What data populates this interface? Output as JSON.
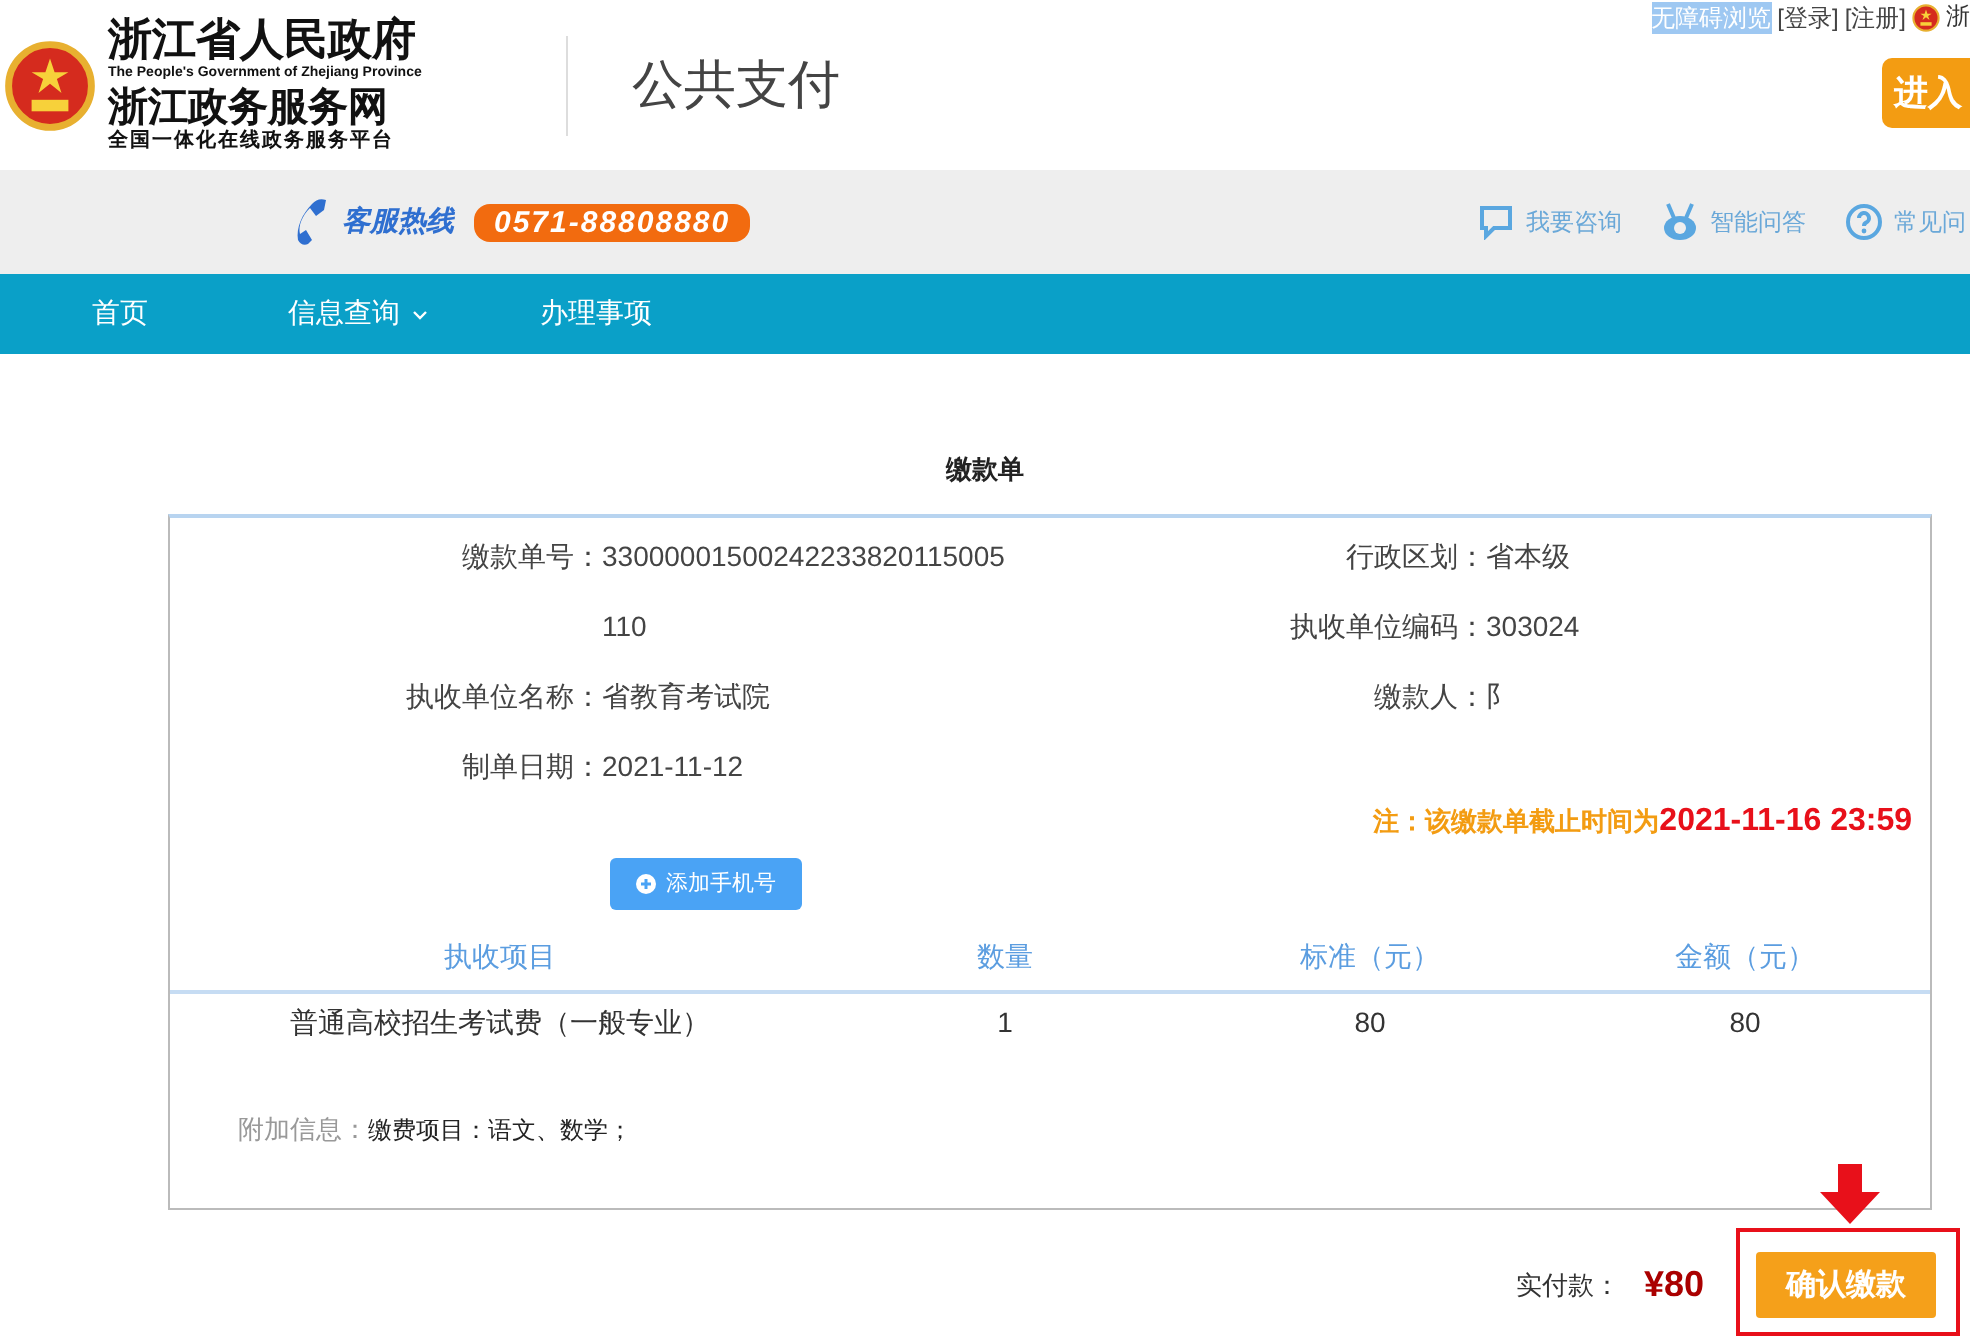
{
  "header": {
    "site_title": "浙江省人民政府",
    "site_subtitle_en": "The People's Government of Zhejiang Province",
    "site_name": "浙江政务服务网",
    "site_slogan": "全国一体化在线政务服务平台",
    "page_title": "公共支付",
    "top_links": [
      {
        "label": "无障碍浏览",
        "highlighted": true
      },
      {
        "label": "[登录]",
        "highlighted": false
      },
      {
        "label": "[注册]",
        "highlighted": false
      }
    ],
    "region_label": "浙",
    "enter_button": "进入"
  },
  "hotline": {
    "label": "客服热线",
    "number": "0571-88808880"
  },
  "help_links": [
    {
      "label": "我要咨询",
      "kind": "chat"
    },
    {
      "label": "智能问答",
      "kind": "robot"
    },
    {
      "label": "常见问",
      "kind": "question"
    }
  ],
  "nav": [
    {
      "label": "首页",
      "dropdown": false
    },
    {
      "label": "信息查询",
      "dropdown": true
    },
    {
      "label": "办理事项",
      "dropdown": false
    }
  ],
  "bill": {
    "title": "缴款单",
    "left_fields": [
      {
        "label": "缴款单号：",
        "value": "33000001500242233820115005110"
      },
      {
        "label": "执收单位名称：",
        "value": "省教育考试院"
      },
      {
        "label": "制单日期：",
        "value": "2021-11-12"
      }
    ],
    "right_fields": [
      {
        "label": "行政区划：",
        "value": "省本级"
      },
      {
        "label": "执收单位编码：",
        "value": "303024"
      },
      {
        "label": "缴款人：",
        "value": "阝"
      }
    ],
    "note": {
      "prefix": "注：该缴款单截止时间为",
      "deadline": "2021-11-16 23:59"
    },
    "add_phone_button": "添加手机号",
    "table": {
      "columns": [
        "执收项目",
        "数量",
        "标准（元）",
        "金额（元）"
      ],
      "rows": [
        [
          "普通高校招生考试费（一般专业）",
          "1",
          "80",
          "80"
        ]
      ]
    },
    "extra_info": {
      "label": "附加信息：",
      "value": "缴费项目：语文、数学；"
    }
  },
  "footer": {
    "paid_label": "实付款：",
    "amount": "¥80",
    "confirm_button": "确认缴款"
  }
}
